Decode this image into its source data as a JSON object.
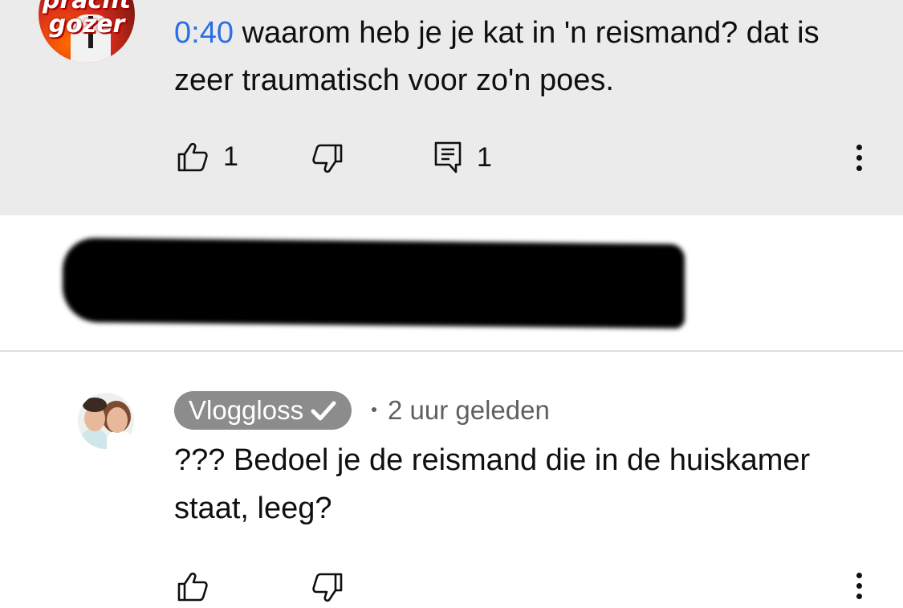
{
  "top_comment": {
    "avatar_logo_line1": "pracht",
    "avatar_logo_line2": "gozer",
    "timestamp_link": "0:40",
    "text": " waarom heb je je kat in 'n reismand? dat is zeer traumatisch voor zo'n poes.",
    "like_count": "1",
    "reply_count": "1",
    "icons": [
      "thumbs-up-icon",
      "thumbs-down-icon",
      "comment-icon",
      "more-vert-icon"
    ]
  },
  "reply": {
    "author": "Vloggloss",
    "time_ago": "2 uur geleden",
    "text": "??? Bedoel je de reismand die in de huiskamer staat, leeg?",
    "icons": [
      "thumbs-up-icon",
      "thumbs-down-icon",
      "more-vert-icon",
      "verified-check-icon"
    ]
  },
  "colors": {
    "highlight_bg": "#ebebeb",
    "link_blue": "#2b6ee6",
    "author_chip": "#8c8c8c",
    "meta_gray": "#606060"
  }
}
